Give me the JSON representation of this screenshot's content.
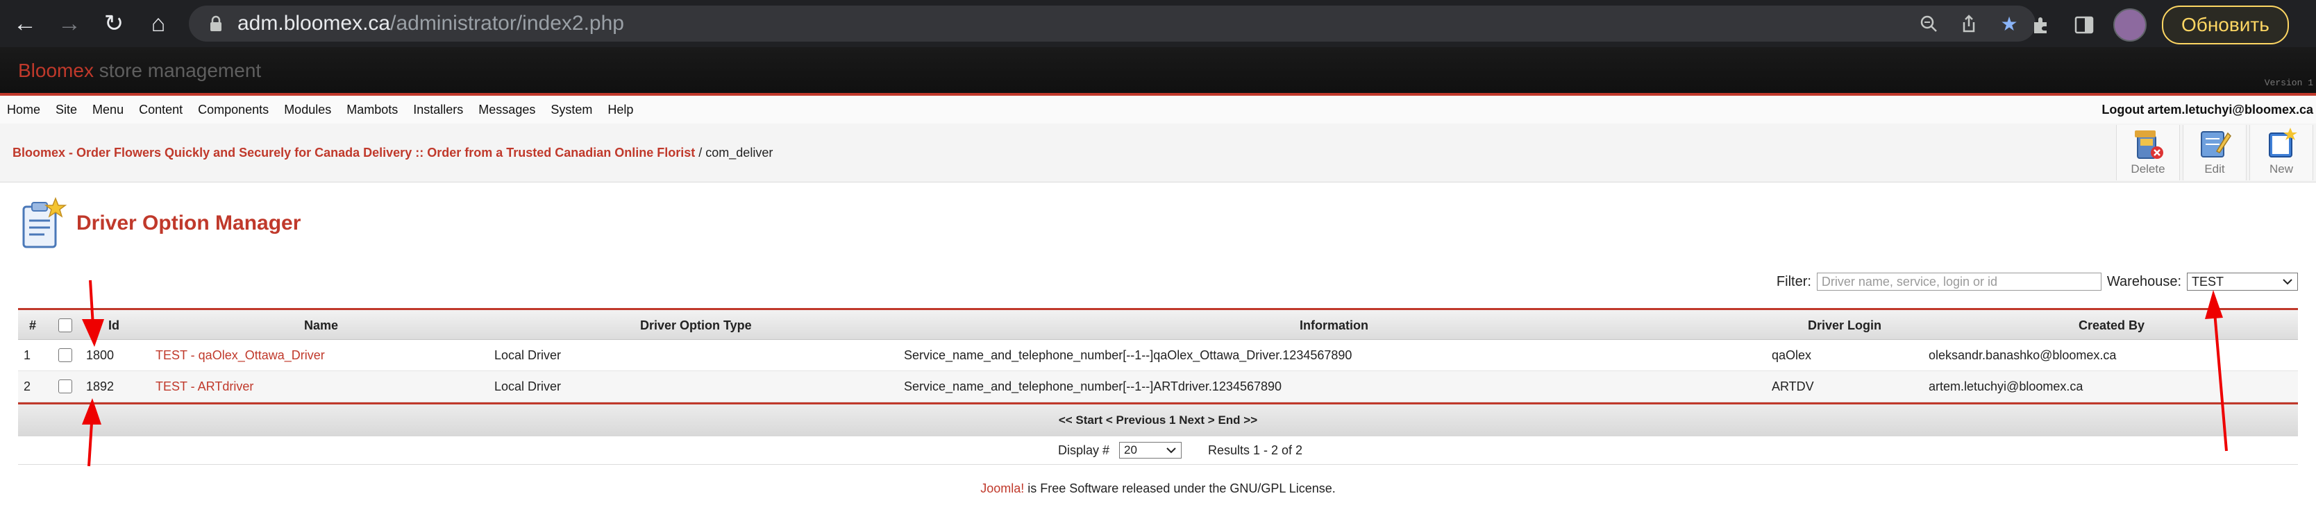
{
  "browser": {
    "url_host": "adm.bloomex.ca",
    "url_path": "/administrator/index2.php",
    "update_label": "Обновить"
  },
  "header": {
    "brand": "Bloomex",
    "subtitle": "store management",
    "version": "Version 1"
  },
  "menu": {
    "items": [
      "Home",
      "Site",
      "Menu",
      "Content",
      "Components",
      "Modules",
      "Mambots",
      "Installers",
      "Messages",
      "System",
      "Help"
    ],
    "logout": "Logout artem.letuchyi@bloomex.ca"
  },
  "pathway": {
    "site": "Bloomex - Order Flowers Quickly and Securely for Canada Delivery :: Order from a Trusted Canadian Online Florist",
    "separator": " / ",
    "component": "com_deliver"
  },
  "toolbar": {
    "delete": "Delete",
    "edit": "Edit",
    "new": "New"
  },
  "page": {
    "title": "Driver Option Manager"
  },
  "filter": {
    "label": "Filter:",
    "placeholder": "Driver name, service, login or id",
    "value": "",
    "warehouse_label": "Warehouse:",
    "warehouse_value": "TEST"
  },
  "table": {
    "columns": [
      "#",
      "Id",
      "Name",
      "Driver Option Type",
      "Information",
      "Driver Login",
      "Created By"
    ],
    "rows": [
      {
        "num": "1",
        "id": "1800",
        "name": "TEST - qaOlex_Ottawa_Driver",
        "type": "Local Driver",
        "info": "Service_name_and_telephone_number[--1--]qaOlex_Ottawa_Driver.1234567890",
        "login": "qaOlex",
        "created_by": "oleksandr.banashko@bloomex.ca"
      },
      {
        "num": "2",
        "id": "1892",
        "name": "TEST - ARTdriver",
        "type": "Local Driver",
        "info": "Service_name_and_telephone_number[--1--]ARTdriver.1234567890",
        "login": "ARTDV",
        "created_by": "artem.letuchyi@bloomex.ca"
      }
    ]
  },
  "pager": {
    "nav": "<< Start < Previous 1 Next > End >>",
    "display_label": "Display #",
    "display_value": "20",
    "results": "Results 1 - 2 of 2"
  },
  "footer": {
    "joomla": "Joomla!",
    "text": " is Free Software released under the GNU/GPL License."
  },
  "colors": {
    "accent": "#c0392b",
    "chrome": "#202124",
    "update": "#fdd663"
  }
}
